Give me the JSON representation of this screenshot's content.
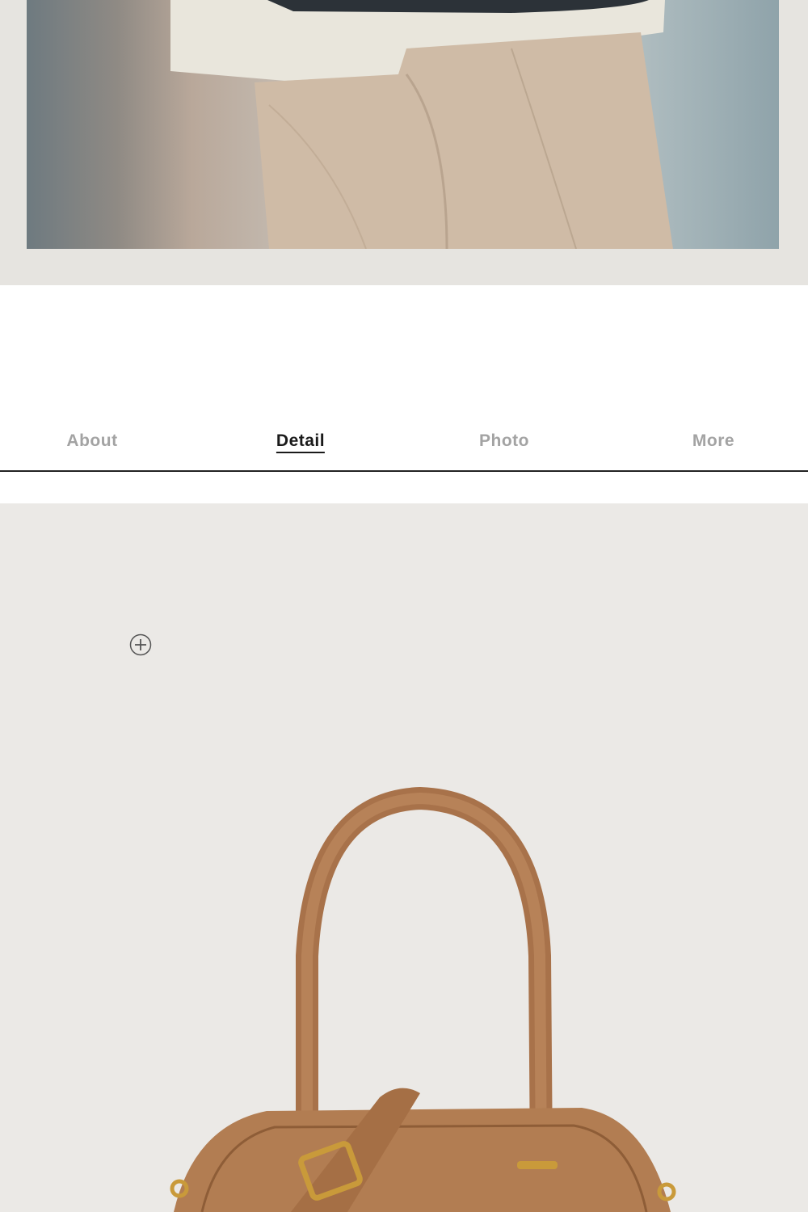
{
  "tabs": [
    {
      "label": "About",
      "active": false
    },
    {
      "label": "Detail",
      "active": true
    },
    {
      "label": "Photo",
      "active": false
    },
    {
      "label": "More",
      "active": false
    }
  ],
  "icons": {
    "zoom": "plus-circle-icon"
  },
  "colors": {
    "accent": "#1a1a1a",
    "inactive_tab": "#a3a3a3",
    "product_bg": "#ebe9e6",
    "bag_leather": "#b27d52"
  }
}
